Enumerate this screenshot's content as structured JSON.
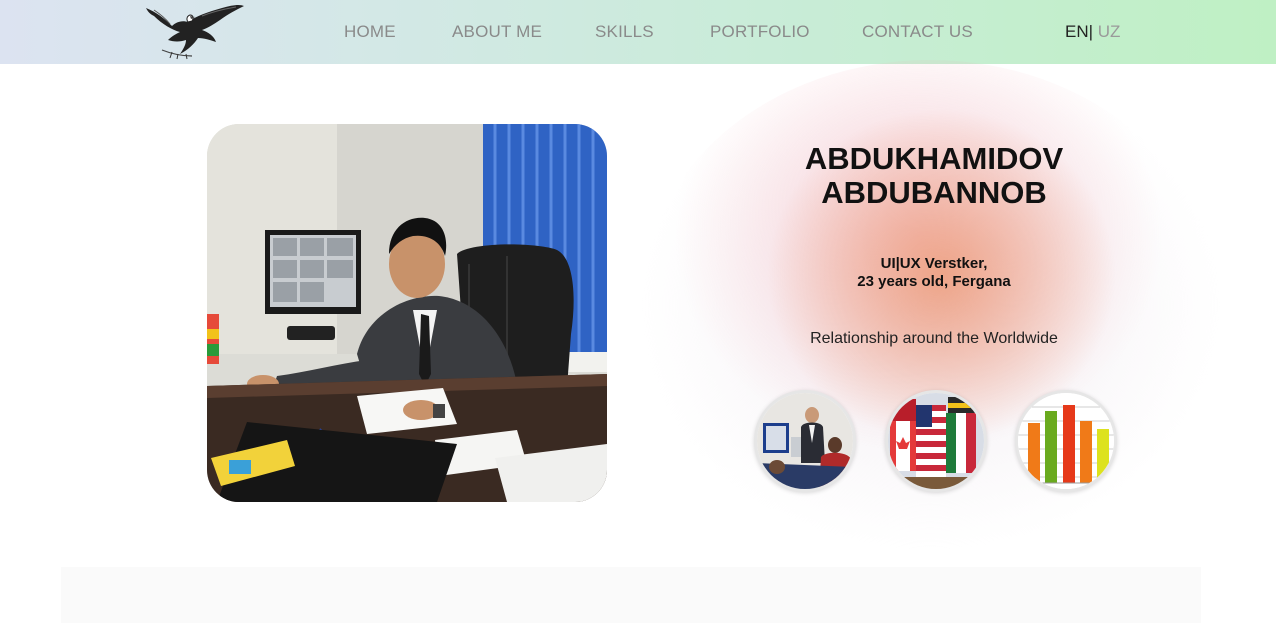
{
  "header": {
    "logo_icon": "eagle-logo-icon",
    "nav": [
      "HOME",
      "ABOUT ME",
      "SKILLS",
      "PORTFOLIO",
      "CONTACT US"
    ],
    "lang_en": "EN",
    "lang_sep": "|",
    "lang_uz": "UZ"
  },
  "profile": {
    "name_line1": "ABDUKHAMIDOV",
    "name_line2": "ABDUBANNOB",
    "role": "UI|UX Verstker,",
    "age_city": "23 years old, Fergana",
    "tagline": "Relationship around the Worldwide",
    "photo_icon": "man-at-computer-photo"
  },
  "circles": [
    "presentation-meeting-icon",
    "world-flags-icon",
    "bar-chart-icon"
  ],
  "colors": {
    "header_start": "#dce3f1",
    "header_end": "#bff0c4",
    "nav_text": "#8a8a8a",
    "glow_orange": "#ec966e",
    "glow_pink": "#f4aab4"
  }
}
